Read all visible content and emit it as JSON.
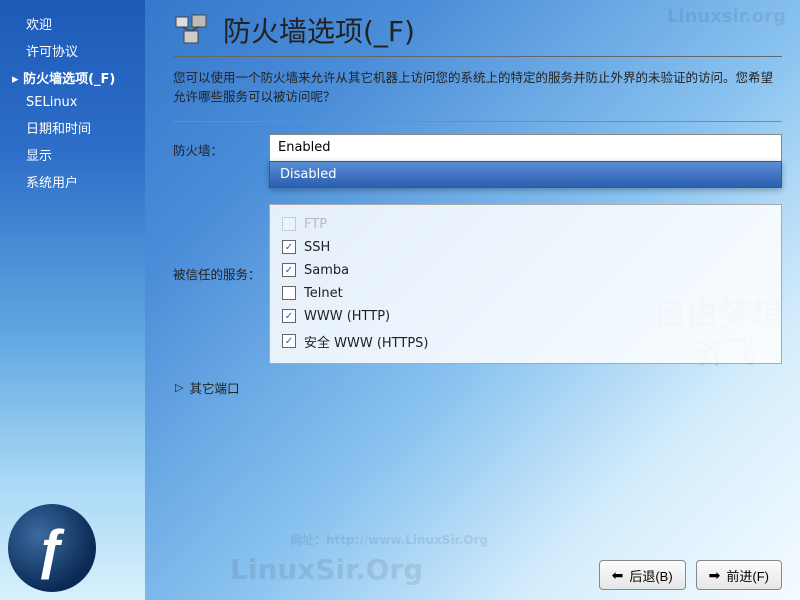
{
  "sidebar": {
    "items": [
      {
        "label": "欢迎",
        "active": false
      },
      {
        "label": "许可协议",
        "active": false
      },
      {
        "label": "防火墙选项(_F)",
        "active": true
      },
      {
        "label": "SELinux",
        "active": false
      },
      {
        "label": "日期和时间",
        "active": false
      },
      {
        "label": "显示",
        "active": false
      },
      {
        "label": "系统用户",
        "active": false
      }
    ]
  },
  "header": {
    "title": "防火墙选项(_F)"
  },
  "description": "您可以使用一个防火墙来允许从其它机器上访问您的系统上的特定的服务并防止外界的未验证的访问。您希望允许哪些服务可以被访问呢？",
  "firewall": {
    "row_label": "防火墙：",
    "selected": "Enabled",
    "options": [
      "Enabled",
      "Disabled"
    ],
    "highlighted_option": "Disabled"
  },
  "services": {
    "row_label": "被信任的服务：",
    "items": [
      {
        "label": "FTP",
        "checked": false,
        "partially_hidden": true
      },
      {
        "label": "SSH",
        "checked": true
      },
      {
        "label": "Samba",
        "checked": true
      },
      {
        "label": "Telnet",
        "checked": false
      },
      {
        "label": "WWW (HTTP)",
        "checked": true
      },
      {
        "label": "安全 WWW (HTTPS)",
        "checked": true
      }
    ]
  },
  "expander": {
    "label": "其它端口"
  },
  "footer": {
    "back_label": "后退(B)",
    "forward_label": "前进(F)"
  },
  "watermarks": {
    "text1": "Linuxsir.org",
    "text2": "自由梦想",
    "text3": "齐飞",
    "url": "网址：http://www.LinuxSir.Org",
    "brand": "LinuxSir.Org"
  },
  "colors": {
    "accent": "#2b5fb0",
    "sidebar_text": "#ffffff"
  }
}
